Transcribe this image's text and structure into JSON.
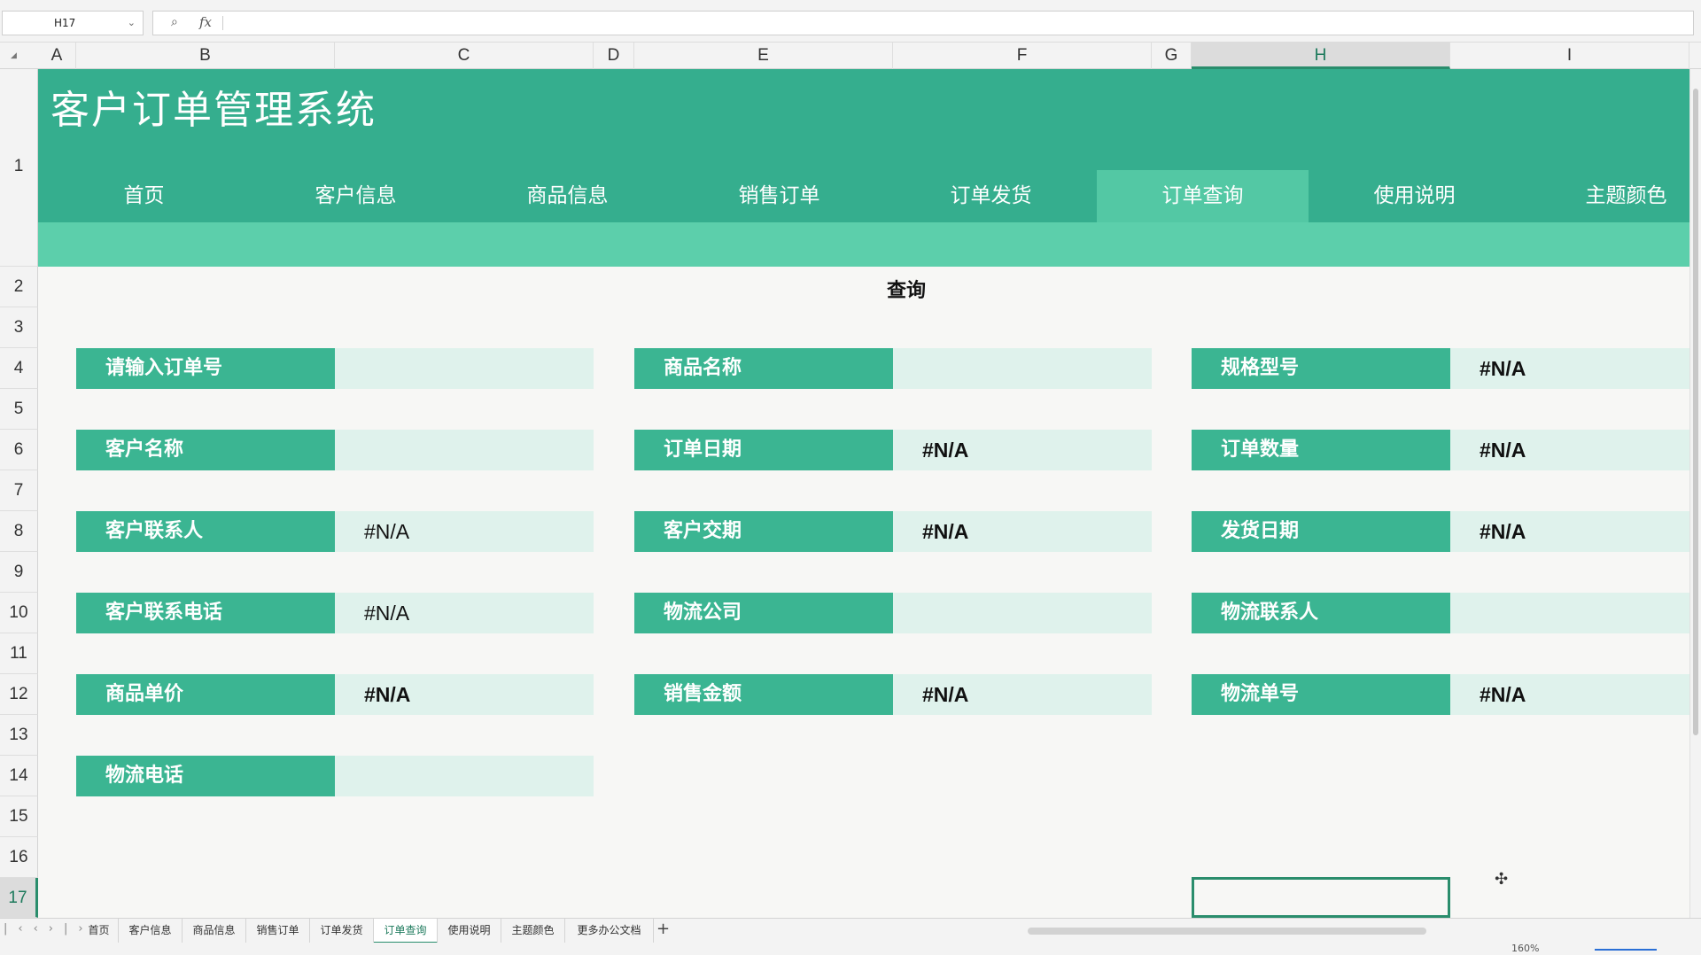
{
  "formula_bar": {
    "name_box": "H17",
    "formula": ""
  },
  "columns": [
    "A",
    "B",
    "C",
    "D",
    "E",
    "F",
    "G",
    "H",
    "I"
  ],
  "rows": [
    "1",
    "2",
    "3",
    "4",
    "5",
    "6",
    "7",
    "8",
    "9",
    "10",
    "11",
    "12",
    "13",
    "14",
    "15",
    "16",
    "17"
  ],
  "header": {
    "title": "客户订单管理系统",
    "nav": [
      "首页",
      "客户信息",
      "商品信息",
      "销售订单",
      "订单发货",
      "订单查询",
      "使用说明",
      "主题颜色"
    ],
    "active_nav": "订单查询"
  },
  "section_title": "查询",
  "fields": {
    "order_no": {
      "label": "请输入订单号",
      "value": ""
    },
    "product_name": {
      "label": "商品名称",
      "value": ""
    },
    "spec": {
      "label": "规格型号",
      "value": "#N/A"
    },
    "customer_name": {
      "label": "客户名称",
      "value": ""
    },
    "order_date": {
      "label": "订单日期",
      "value": "#N/A"
    },
    "order_qty": {
      "label": "订单数量",
      "value": "#N/A"
    },
    "contact": {
      "label": "客户联系人",
      "value": "#N/A"
    },
    "delivery_term": {
      "label": "客户交期",
      "value": "#N/A"
    },
    "ship_date": {
      "label": "发货日期",
      "value": "#N/A"
    },
    "contact_phone": {
      "label": "客户联系电话",
      "value": "#N/A"
    },
    "logistics_co": {
      "label": "物流公司",
      "value": ""
    },
    "logistics_contact": {
      "label": "物流联系人",
      "value": ""
    },
    "unit_price": {
      "label": "商品单价",
      "value": "#N/A"
    },
    "sales_amount": {
      "label": "销售金额",
      "value": "#N/A"
    },
    "tracking_no": {
      "label": "物流单号",
      "value": "#N/A"
    },
    "logistics_phone": {
      "label": "物流电话",
      "value": ""
    }
  },
  "sheet_tabs": [
    "首页",
    "客户信息",
    "商品信息",
    "销售订单",
    "订单发货",
    "订单查询",
    "使用说明",
    "主题颜色",
    "更多办公文档"
  ],
  "active_sheet": "订单查询",
  "status": {
    "zoom": "160%"
  },
  "colors": {
    "banner": "#35ae8e",
    "nav_active": "#53c8a4",
    "label_bg": "#3bb592",
    "value_bg": "#dff2ec"
  }
}
